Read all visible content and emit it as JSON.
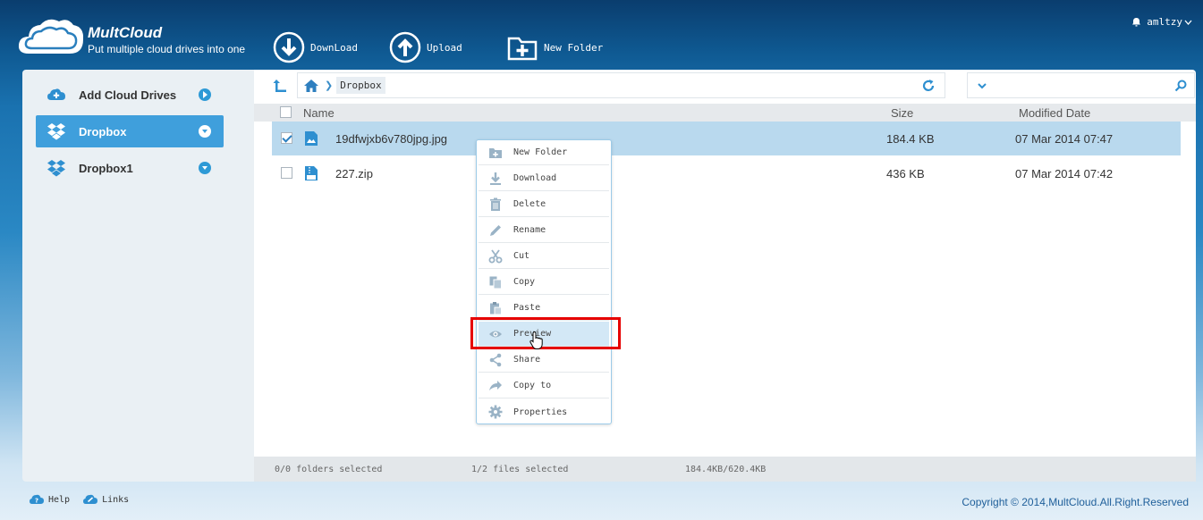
{
  "header": {
    "brand": "MultCloud",
    "tagline": "Put multiple cloud drives into one",
    "username": "amltzy",
    "toolbar": {
      "download_label": "DownLoad",
      "upload_label": "Upload",
      "new_folder_label": "New Folder"
    }
  },
  "sidebar": {
    "items": [
      {
        "label": "Add Cloud Drives",
        "icon": "plus-cloud-icon"
      },
      {
        "label": "Dropbox",
        "icon": "dropbox-icon",
        "active": true
      },
      {
        "label": "Dropbox1",
        "icon": "dropbox-icon"
      }
    ]
  },
  "path": {
    "crumb": "Dropbox"
  },
  "table": {
    "headers": {
      "name": "Name",
      "size": "Size",
      "modified": "Modified Date"
    },
    "rows": [
      {
        "name": "19dfwjxb6v780jpg.jpg",
        "size": "184.4 KB",
        "modified": "07 Mar 2014 07:47",
        "selected": true
      },
      {
        "name": "227.zip",
        "size": "436 KB",
        "modified": "07 Mar 2014 07:42",
        "selected": false
      }
    ]
  },
  "context_menu": {
    "items": [
      {
        "label": "New Folder",
        "icon": "new-folder-icon"
      },
      {
        "label": "Download",
        "icon": "download-icon"
      },
      {
        "label": "Delete",
        "icon": "trash-icon"
      },
      {
        "label": "Rename",
        "icon": "pencil-icon"
      },
      {
        "label": "Cut",
        "icon": "scissors-icon"
      },
      {
        "label": "Copy",
        "icon": "copy-icon"
      },
      {
        "label": "Paste",
        "icon": "paste-icon"
      },
      {
        "label": "Preview",
        "icon": "eye-icon",
        "highlighted": true
      },
      {
        "label": "Share",
        "icon": "share-icon"
      },
      {
        "label": "Copy to",
        "icon": "copy-to-icon"
      },
      {
        "label": "Properties",
        "icon": "gear-icon"
      }
    ]
  },
  "status": {
    "folders": "0/0 folders selected",
    "files": "1/2 files selected",
    "size": "184.4KB/620.4KB"
  },
  "footer": {
    "help": "Help",
    "links": "Links",
    "copyright": "Copyright © 2014,MultCloud.All.Right.Reserved"
  },
  "colors": {
    "accent": "#3f9fdc",
    "selected_row": "#b9d9ee",
    "highlight_border": "#e60000"
  }
}
